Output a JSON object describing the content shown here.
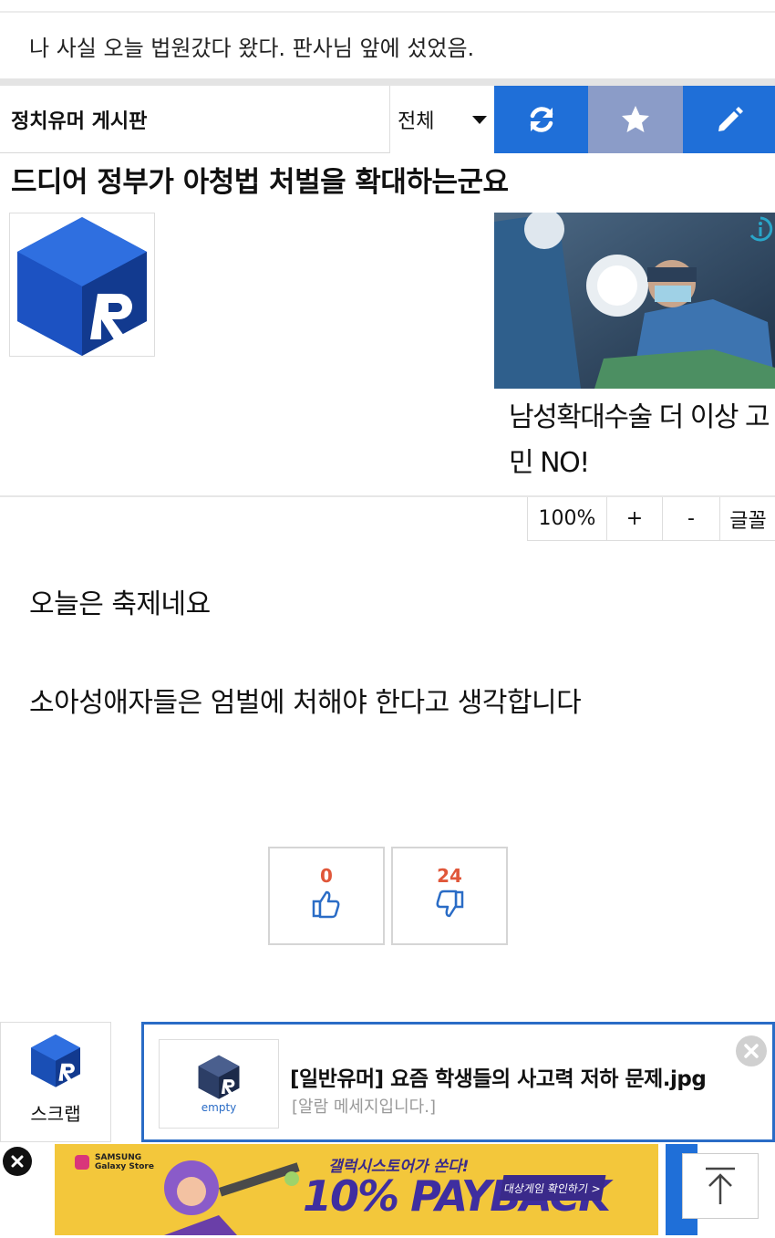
{
  "notice": {
    "text": "나 사실 오늘 법원갔다 왔다. 판사님 앞에 섰었음."
  },
  "board": {
    "title": "정치유머 게시판",
    "filter_selected": "전체",
    "buttons": {
      "refresh_icon": "refresh-icon",
      "favorite_icon": "star-icon",
      "write_icon": "pencil-icon"
    }
  },
  "post": {
    "title": "드디어 정부가 아청법 처벌을 확대하는군요",
    "body": [
      "오늘은 축제네요",
      "소아성애자들은 엄벌에 처해야 한다고 생각합니다"
    ]
  },
  "ad": {
    "text": "남성확대수술 더 이상 고민 NO!"
  },
  "font_tools": {
    "zoom": "100%",
    "plus": "+",
    "minus": "-",
    "font": "글꼴"
  },
  "votes": {
    "up": "0",
    "down": "24"
  },
  "scrap": {
    "label": "스크랩"
  },
  "alarm": {
    "thumb_label": "empty",
    "title": "[일반유머] 요즘 학생들의 사고력 저하 문제.jpg",
    "subtitle": "[알람 메세지입니다.]"
  },
  "banner": {
    "store_line1": "SAMSUNG",
    "store_line2": "Galaxy Store",
    "headline": "갤럭시스토어가 쏜다!",
    "big": "10% PAYBACK",
    "cta": "대상게임 확인하기 >"
  },
  "colors": {
    "brand_blue": "#1f6fd8",
    "star_button": "#8b9cc8",
    "vote_count": "#e0573a",
    "alarm_border": "#2a6cc6"
  }
}
